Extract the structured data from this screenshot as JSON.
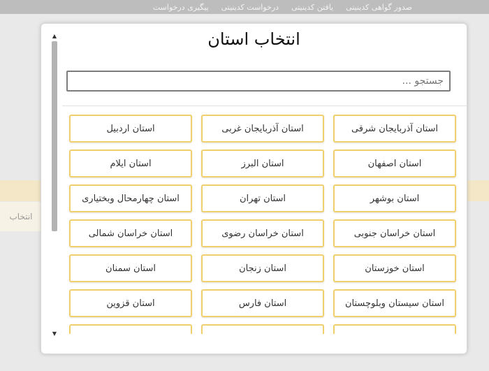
{
  "background": {
    "nav": [
      "صدور گواهی کدینیتی",
      "یافتن کدینیتی",
      "درخواست کدینیتی",
      "پیگیری درخواست"
    ],
    "left_button": "انتخاب"
  },
  "modal": {
    "title": "انتخاب استان",
    "search_placeholder": "جستجو ...",
    "provinces": [
      "استان آذربایجان شرقی",
      "استان آذربایجان غربی",
      "استان اردبیل",
      "استان اصفهان",
      "استان البرز",
      "استان ایلام",
      "استان بوشهر",
      "استان تهران",
      "استان چهارمحال وبختیاری",
      "استان خراسان جنوبی",
      "استان خراسان رضوی",
      "استان خراسان شمالی",
      "استان خوزستان",
      "استان زنجان",
      "استان سمنان",
      "استان سیستان وبلوچستان",
      "استان فارس",
      "استان قزوین"
    ]
  }
}
